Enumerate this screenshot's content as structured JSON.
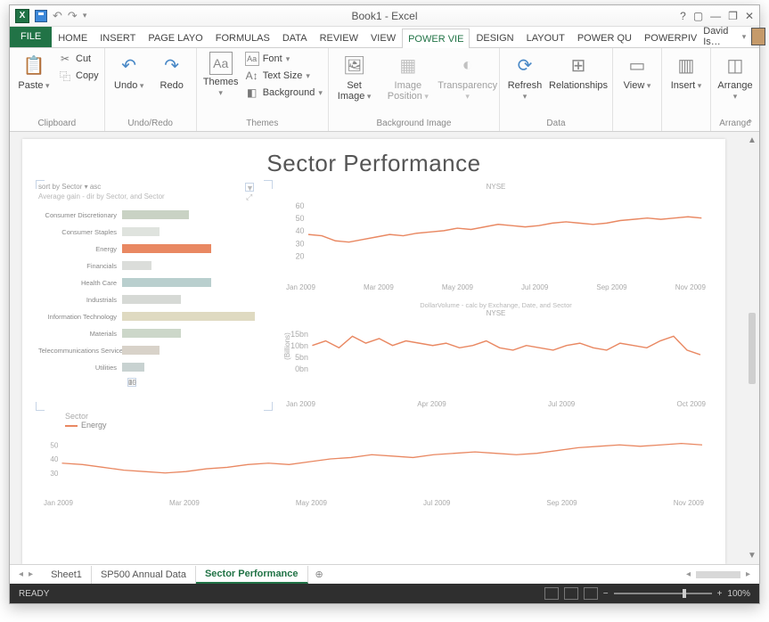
{
  "titlebar": {
    "app_icon": "X",
    "title": "Book1 - Excel",
    "help": "?",
    "ribbon_opts": "▢",
    "min": "—",
    "max": "❐",
    "close": "✕"
  },
  "tabs": {
    "file": "FILE",
    "items": [
      "HOME",
      "INSERT",
      "PAGE LAYO",
      "FORMULAS",
      "DATA",
      "REVIEW",
      "VIEW",
      "POWER VIE",
      "DESIGN",
      "LAYOUT",
      "POWER QU",
      "POWERPIV"
    ],
    "active_index": 7,
    "user": "David Is…"
  },
  "ribbon": {
    "clipboard": {
      "label": "Clipboard",
      "paste": "Paste",
      "cut": "Cut",
      "copy": "Copy"
    },
    "undo": {
      "label": "Undo/Redo",
      "undo": "Undo",
      "redo": "Redo"
    },
    "themes": {
      "label": "Themes",
      "themes": "Themes",
      "font": "Font",
      "textsize": "Text Size",
      "background": "Background"
    },
    "bgimg": {
      "label": "Background Image",
      "set": "Set Image",
      "image": "Image Position",
      "trans": "Transparency"
    },
    "data": {
      "label": "Data",
      "refresh": "Refresh",
      "rel": "Relationships"
    },
    "view": {
      "label": "",
      "view": "View"
    },
    "insert": {
      "label": "",
      "insert": "Insert"
    },
    "arrange": {
      "label": "Arrange",
      "arrange": "Arrange"
    }
  },
  "powerview": {
    "title": "Sector Performance",
    "sort_text": "sort by  Sector  ▾  asc",
    "bar_subtitle": "Average gain - dir by Sector, and Sector",
    "line1_title": "NYSE",
    "line2_sub": "DollarVolume - calc by Exchange, Date, and Sector",
    "line2_title": "NYSE",
    "line2_ylabel": "(Billions)",
    "legend_label": "Sector",
    "legend_item": "Energy"
  },
  "chart_data": [
    {
      "type": "bar",
      "title": "Average gain - dir by Sector, and Sector",
      "orientation": "horizontal",
      "categories": [
        "Consumer Discretionary",
        "Consumer Staples",
        "Energy",
        "Financials",
        "Health Care",
        "Industrials",
        "Information Technology",
        "Materials",
        "Telecommunications Services",
        "Utilities"
      ],
      "values": [
        9,
        5,
        12,
        4,
        12,
        8,
        18,
        8,
        5,
        3
      ],
      "colors": [
        "#c9d2c4",
        "#dfe3de",
        "#e98862",
        "#dbddda",
        "#b9cfce",
        "#d6d9d5",
        "#dfdac1",
        "#ccd7c9",
        "#d8d2c9",
        "#c8d2d1"
      ],
      "xlim": [
        0,
        20
      ],
      "xticks": [
        0,
        5,
        10,
        15,
        20
      ]
    },
    {
      "type": "line",
      "title": "NYSE",
      "xlabel": "",
      "ylabel": "",
      "ylim": [
        20,
        60
      ],
      "yticks": [
        20,
        30,
        40,
        50,
        60
      ],
      "x": [
        "Jan 2009",
        "Mar 2009",
        "May 2009",
        "Jul 2009",
        "Sep 2009",
        "Nov 2009"
      ],
      "series": [
        {
          "name": "Energy",
          "color": "#e98862",
          "values": [
            37,
            36,
            32,
            31,
            33,
            35,
            37,
            36,
            38,
            39,
            40,
            42,
            41,
            43,
            45,
            44,
            43,
            44,
            46,
            47,
            46,
            45,
            46,
            48,
            49,
            50,
            49,
            50,
            51,
            50
          ]
        }
      ]
    },
    {
      "type": "line",
      "title": "NYSE",
      "subtitle": "DollarVolume - calc by Exchange, Date, and Sector",
      "ylabel": "(Billions)",
      "ylim": [
        0,
        15
      ],
      "yticks": [
        0,
        5,
        10,
        15
      ],
      "ytick_suffix": "bn",
      "x": [
        "Jan 2009",
        "Apr 2009",
        "Jul 2009",
        "Oct 2009"
      ],
      "series": [
        {
          "name": "Energy",
          "color": "#e98862",
          "values": [
            10,
            12,
            9,
            14,
            11,
            13,
            10,
            12,
            11,
            10,
            11,
            9,
            10,
            12,
            9,
            8,
            10,
            9,
            8,
            10,
            11,
            9,
            8,
            11,
            10,
            9,
            12,
            14,
            8,
            6
          ]
        }
      ]
    },
    {
      "type": "line",
      "title": "",
      "ylim": [
        30,
        50
      ],
      "yticks": [
        30,
        40,
        50
      ],
      "x": [
        "Jan 2009",
        "Mar 2009",
        "May 2009",
        "Jul 2009",
        "Sep 2009",
        "Nov 2009"
      ],
      "series": [
        {
          "name": "Energy",
          "color": "#e98862",
          "values": [
            37,
            36,
            34,
            32,
            31,
            30,
            31,
            33,
            34,
            36,
            37,
            36,
            38,
            40,
            41,
            43,
            42,
            41,
            43,
            44,
            45,
            44,
            43,
            44,
            46,
            48,
            49,
            50,
            49,
            50,
            51,
            50
          ]
        }
      ]
    }
  ],
  "sheets": {
    "items": [
      "Sheet1",
      "SP500 Annual Data",
      "Sector Performance"
    ],
    "active_index": 2
  },
  "status": {
    "ready": "READY",
    "zoom": "100%",
    "minus": "−",
    "plus": "+"
  }
}
